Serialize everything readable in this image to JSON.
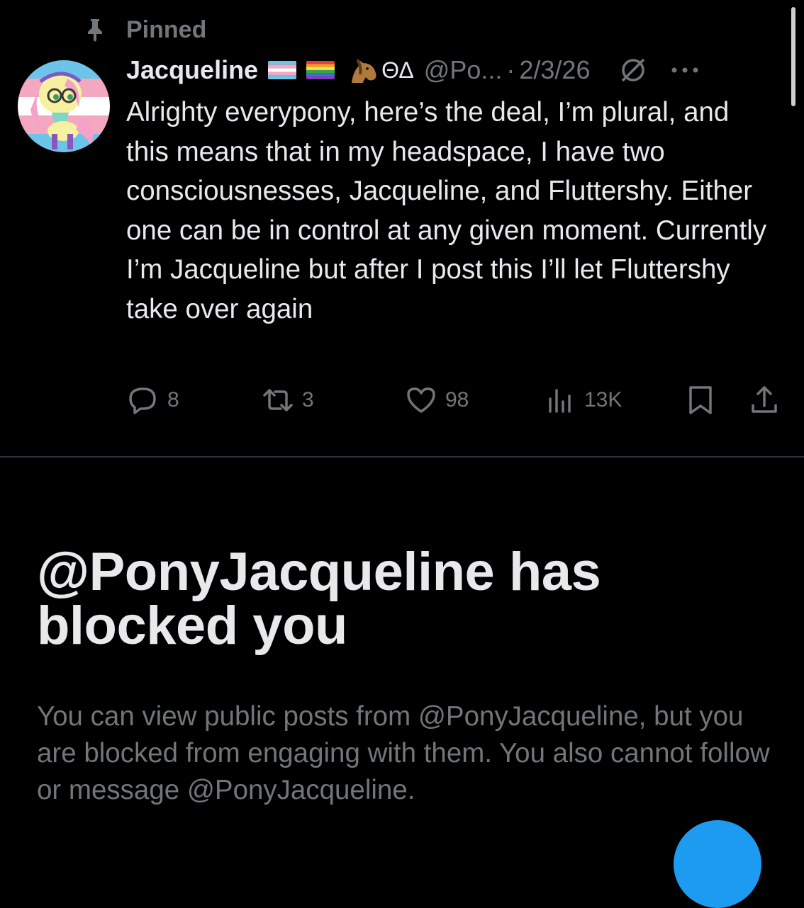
{
  "pinned_label": "Pinned",
  "post": {
    "display_name": "Jacqueline",
    "name_suffix": "ΘΔ",
    "handle": "@Po...",
    "separator": "·",
    "date": "2/3/26",
    "text": "Alrighty everypony, here’s the deal, I’m plural, and this means that in my headspace, I have two consciousnesses, Jacqueline, and Fluttershy. Either one can be in control at any given moment. Currently I’m Jacqueline but after I post this I’ll let Fluttershy take over again",
    "stats": {
      "replies": "8",
      "reposts": "3",
      "likes": "98",
      "views": "13K"
    },
    "icons": [
      "pin-icon",
      "transgender-flag-icon",
      "rainbow-flag-icon",
      "horse-emoji-icon",
      "muted-icon",
      "more-icon",
      "reply-icon",
      "repost-icon",
      "like-icon",
      "views-icon",
      "bookmark-icon",
      "share-icon"
    ]
  },
  "blocked": {
    "title": "@PonyJacqueline has blocked you",
    "description": "You can view public posts from @PonyJacqueline, but you are blocked from engaging with them. You also cannot follow or message @PonyJacqueline."
  },
  "colors": {
    "background": "#000000",
    "primary_text": "#e7e9ea",
    "secondary_text": "#71767b",
    "divider": "#2f3336",
    "accent": "#1d9bf0"
  }
}
